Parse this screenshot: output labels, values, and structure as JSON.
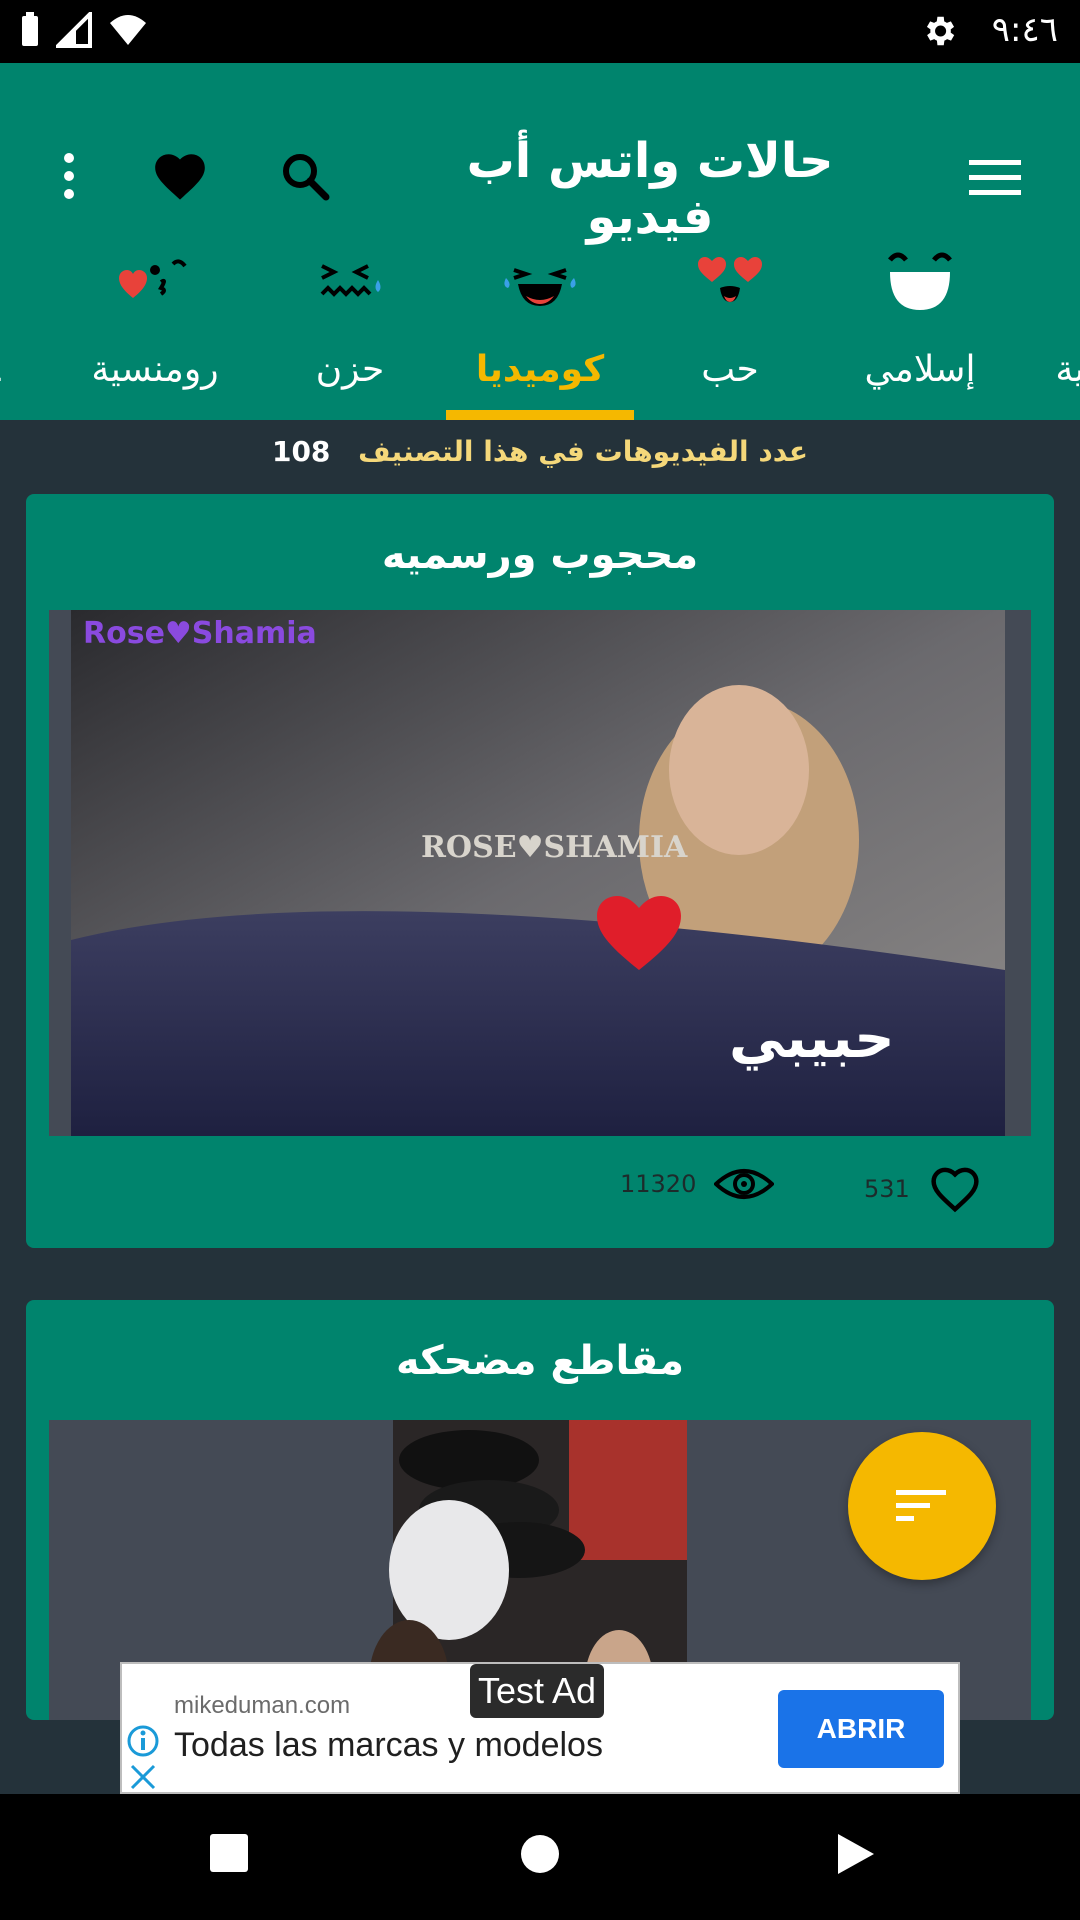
{
  "status_bar": {
    "time": "٩:٤٦"
  },
  "app_bar": {
    "title": "حالات واتس أب فيديو"
  },
  "tabs": [
    {
      "label": "رومنسية",
      "emoji": "kiss-emoji"
    },
    {
      "label": "حزن",
      "emoji": "crying-emoji"
    },
    {
      "label": "كوميديا",
      "emoji": "laughing-emoji",
      "active": true
    },
    {
      "label": "حب",
      "emoji": "heart-eyes-emoji"
    },
    {
      "label": "إسلامي",
      "emoji": "smiling-emoji"
    }
  ],
  "count": {
    "label": "عدد الفيديوهات في هذا التصنيف",
    "value": "108"
  },
  "videos": [
    {
      "title": "محجوب ورسميه",
      "views": "11320",
      "likes": "531",
      "watermark_top": "Rose♥Shamia",
      "watermark_mid": "ROSE♥SHAMIA",
      "overlay_text": "حبيبي"
    },
    {
      "title": "مقاطع مضحكه"
    }
  ],
  "ad": {
    "badge": "Test Ad",
    "domain": "mikeduman.com",
    "headline": "Todas las marcas y modelos",
    "cta": "ABRIR"
  },
  "colors": {
    "primary": "#00846d",
    "accent": "#f5b800",
    "background": "#24323a"
  }
}
